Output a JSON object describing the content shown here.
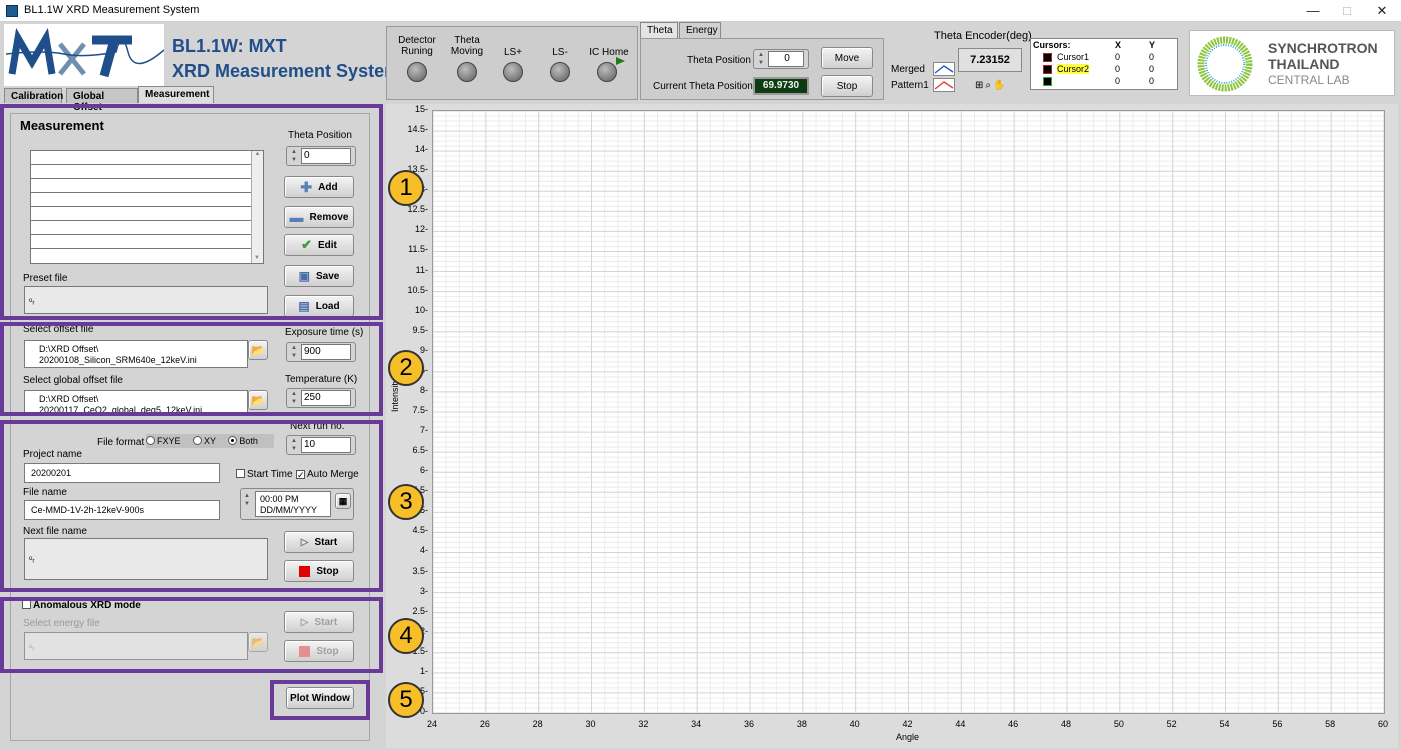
{
  "window": {
    "title": "BL1.1W XRD Measurement System"
  },
  "header": {
    "title_line1": "BL1.1W: MXT",
    "title_line2": "XRD Measurement System",
    "logo_text": "MXT"
  },
  "tabs": [
    "Calibration",
    "Global Offset",
    "Measurement"
  ],
  "measurement": {
    "heading": "Measurement",
    "theta_position_label": "Theta Position",
    "theta_position_value": "0",
    "buttons": {
      "add": "Add",
      "remove": "Remove",
      "edit": "Edit",
      "save": "Save",
      "load": "Load"
    },
    "preset_file_label": "Preset file",
    "preset_file_value": "",
    "select_offset_label": "Select offset file",
    "offset_file_line1": "D:\\XRD Offset\\",
    "offset_file_line2": "20200108_Silicon_SRM640e_12keV.ini",
    "select_global_label": "Select global offset file",
    "global_file_line1": "D:\\XRD Offset\\",
    "global_file_line2": "20200117_CeO2_global_deg5_12keV.ini",
    "exposure_label": "Exposure time (s)",
    "exposure_value": "900",
    "temperature_label": "Temperature (K)",
    "temperature_value": "250",
    "next_run_label": "Next run no.",
    "next_run_value": "10",
    "file_format_label": "File format",
    "formats": [
      "FXYE",
      "XY",
      "Both"
    ],
    "selected_format": "Both",
    "project_label": "Project name",
    "project_value": "20200201",
    "start_time_label": "Start Time",
    "auto_merge_label": "Auto Merge",
    "time_value": "00:00 PM",
    "date_value": "DD/MM/YYYY",
    "file_name_label": "File name",
    "file_name_value": "Ce-MMD-1V-2h-12keV-900s",
    "next_file_label": "Next file name",
    "start_label": "Start",
    "stop_label": "Stop",
    "anomalous_label": "Anomalous XRD mode",
    "select_energy_label": "Select energy file",
    "plot_window_label": "Plot Window"
  },
  "status": {
    "detector": "Detector Runing",
    "theta_moving": "Theta Moving",
    "ls_plus": "LS+",
    "ls_minus": "LS-",
    "ic_home": "IC Home"
  },
  "theta_tabs": [
    "Theta",
    "Energy"
  ],
  "theta_panel": {
    "theta_position_label": "Theta Position",
    "theta_position_value": "0",
    "current_label": "Current Theta Position",
    "current_value": "69.9730",
    "move": "Move",
    "stop": "Stop"
  },
  "encoder": {
    "label": "Theta Encoder(deg)",
    "value": "7.23152"
  },
  "legend": {
    "merged": "Merged",
    "pattern1": "Pattern1"
  },
  "cursors": {
    "title": "Cursors:",
    "col_x": "X",
    "col_y": "Y",
    "rows": [
      {
        "name": "Cursor1",
        "x": "0",
        "y": "0"
      },
      {
        "name": "Cursor2",
        "x": "0",
        "y": "0"
      },
      {
        "name": "",
        "x": "0",
        "y": "0"
      }
    ]
  },
  "synchrotron": {
    "line1": "SYNCHROTRON",
    "line2": "THAILAND",
    "line3": "CENTRAL LAB"
  },
  "annotations": [
    "1",
    "2",
    "3",
    "4",
    "5"
  ],
  "chart_data": {
    "type": "line",
    "xlabel": "Angle",
    "ylabel": "Intensity",
    "xlim": [
      24,
      60
    ],
    "ylim": [
      0,
      15
    ],
    "x_ticks": [
      24,
      26,
      28,
      30,
      32,
      34,
      36,
      38,
      40,
      42,
      44,
      46,
      48,
      50,
      52,
      54,
      56,
      58,
      60
    ],
    "y_ticks": [
      0,
      0.5,
      1,
      1.5,
      2,
      2.5,
      3,
      3.5,
      4,
      4.5,
      5,
      5.5,
      6,
      6.5,
      7,
      7.5,
      8,
      8.5,
      9,
      9.5,
      10,
      10.5,
      11,
      11.5,
      12,
      12.5,
      13,
      13.5,
      14,
      14.5,
      15
    ],
    "grid": true,
    "series": []
  }
}
